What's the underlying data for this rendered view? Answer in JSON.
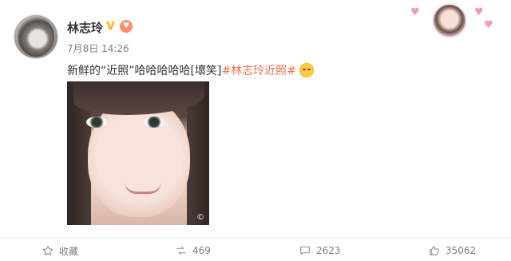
{
  "post": {
    "user": {
      "name": "林志玲",
      "vip_badge": "V",
      "fan_badge": "♥"
    },
    "timestamp": "7月8日 14:26",
    "text_prefix": "新鲜的“近照”哈哈哈哈哈[壞笑]",
    "topic": "#林志玲近照#",
    "emoji_icon": "smirk-emoji-icon",
    "photo_watermark": "©"
  },
  "actions": {
    "favorite": {
      "icon": "star-outline-icon",
      "label": "收藏"
    },
    "repost": {
      "icon": "repost-icon",
      "count": "469"
    },
    "comment": {
      "icon": "comment-icon",
      "count": "2623"
    },
    "like": {
      "icon": "thumb-up-icon",
      "count": "35062"
    }
  },
  "colors": {
    "topic": "#eb7350",
    "muted": "#808080",
    "vip": "#f7b500",
    "fan": "#ff8a65"
  }
}
